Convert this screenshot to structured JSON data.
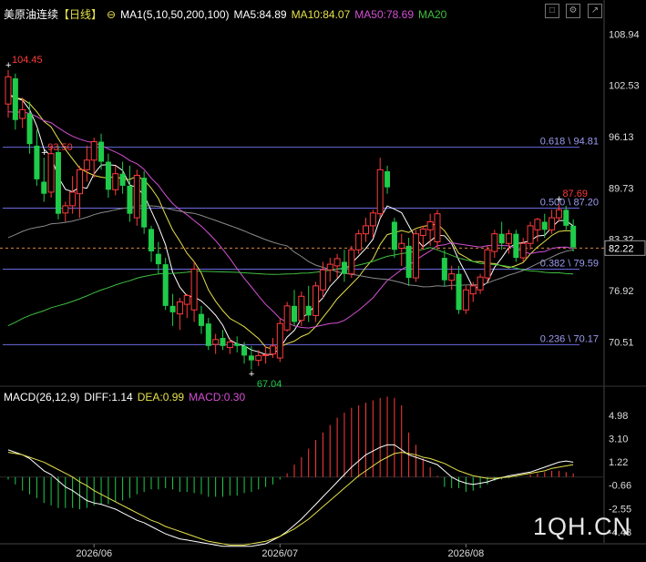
{
  "header": {
    "instrument": "美原油连续",
    "period": "【日线】",
    "ma_group": "MA1(5,10,50,200,100)",
    "ma5": "MA5:84.89",
    "ma10": "MA10:84.07",
    "ma50": "MA50:78.69",
    "ma20": "MA20",
    "colors": {
      "ma5": "#ffffff",
      "ma10": "#e6e04a",
      "ma50": "#d44fd4",
      "ma20": "#3fbf3f",
      "ma_group": "#ffffff"
    }
  },
  "macd_header": {
    "title": "MACD(26,12,9)",
    "diff": "DIFF:1.14",
    "dea": "DEA:0.99",
    "macd": "MACD:0.30"
  },
  "controls": [
    "minimize-icon",
    "settings-icon",
    "expand-icon"
  ],
  "watermark": "1QH.CN",
  "chart_data": [
    {
      "type": "candlestick",
      "price_axis_ticks": [
        "108.94",
        "102.53",
        "96.13",
        "89.73",
        "83.32",
        "76.92",
        "70.51"
      ],
      "ylim": [
        66,
        110
      ],
      "current_price": "82.22",
      "date_labels": [
        "2026/06",
        "2026/07",
        "2026/08"
      ],
      "fibonacci_levels": [
        {
          "ratio": "0.618",
          "price": 94.81,
          "label": "0.618 \\ 94.81"
        },
        {
          "ratio": "0.500",
          "price": 87.2,
          "label": "0.500 \\ 87.20"
        },
        {
          "ratio": "0.382",
          "price": 79.59,
          "label": "0.382 \\ 79.59"
        },
        {
          "ratio": "0.236",
          "price": 70.17,
          "label": "0.236 \\ 70.17"
        }
      ],
      "annotations": [
        {
          "label": "104.45",
          "type": "high"
        },
        {
          "label": "93.50",
          "type": "high"
        },
        {
          "label": "87.69",
          "type": "high"
        },
        {
          "label": "67.04",
          "type": "low"
        }
      ],
      "candles": [
        {
          "o": 100.2,
          "h": 104.45,
          "l": 98.5,
          "c": 103.6
        },
        {
          "o": 103.4,
          "h": 104.0,
          "l": 97.0,
          "c": 98.2
        },
        {
          "o": 98.4,
          "h": 101.0,
          "l": 97.2,
          "c": 99.5
        },
        {
          "o": 99.0,
          "h": 100.5,
          "l": 94.0,
          "c": 95.2
        },
        {
          "o": 95.0,
          "h": 97.0,
          "l": 90.0,
          "c": 90.8
        },
        {
          "o": 90.5,
          "h": 93.5,
          "l": 88.0,
          "c": 89.0
        },
        {
          "o": 89.2,
          "h": 95.0,
          "l": 88.5,
          "c": 94.0
        },
        {
          "o": 94.2,
          "h": 95.0,
          "l": 85.8,
          "c": 86.5
        },
        {
          "o": 86.6,
          "h": 88.0,
          "l": 85.5,
          "c": 87.5
        },
        {
          "o": 87.5,
          "h": 91.2,
          "l": 86.5,
          "c": 89.2
        },
        {
          "o": 89.0,
          "h": 92.5,
          "l": 86.0,
          "c": 92.0
        },
        {
          "o": 92.0,
          "h": 95.0,
          "l": 90.5,
          "c": 93.2
        },
        {
          "o": 93.2,
          "h": 96.0,
          "l": 91.0,
          "c": 95.5
        },
        {
          "o": 95.5,
          "h": 96.5,
          "l": 92.0,
          "c": 93.0
        },
        {
          "o": 93.0,
          "h": 94.0,
          "l": 88.5,
          "c": 89.5
        },
        {
          "o": 89.5,
          "h": 92.5,
          "l": 88.8,
          "c": 91.5
        },
        {
          "o": 91.5,
          "h": 93.0,
          "l": 89.0,
          "c": 90.0
        },
        {
          "o": 90.0,
          "h": 92.5,
          "l": 85.5,
          "c": 86.5
        },
        {
          "o": 86.0,
          "h": 92.0,
          "l": 85.0,
          "c": 91.3
        },
        {
          "o": 91.0,
          "h": 91.8,
          "l": 84.0,
          "c": 84.8
        },
        {
          "o": 84.6,
          "h": 85.0,
          "l": 80.5,
          "c": 81.8
        },
        {
          "o": 81.5,
          "h": 83.0,
          "l": 79.0,
          "c": 80.2
        },
        {
          "o": 80.2,
          "h": 81.0,
          "l": 74.5,
          "c": 75.0
        },
        {
          "o": 75.0,
          "h": 76.5,
          "l": 72.5,
          "c": 74.2
        },
        {
          "o": 74.0,
          "h": 76.0,
          "l": 72.0,
          "c": 75.5
        },
        {
          "o": 75.2,
          "h": 76.5,
          "l": 73.5,
          "c": 76.3
        },
        {
          "o": 74.5,
          "h": 80.5,
          "l": 73.0,
          "c": 79.6
        },
        {
          "o": 74.0,
          "h": 75.0,
          "l": 71.5,
          "c": 72.5
        },
        {
          "o": 72.8,
          "h": 73.5,
          "l": 69.5,
          "c": 70.0
        },
        {
          "o": 70.2,
          "h": 71.5,
          "l": 69.0,
          "c": 70.8
        },
        {
          "o": 71.0,
          "h": 72.0,
          "l": 69.5,
          "c": 70.0
        },
        {
          "o": 69.8,
          "h": 71.0,
          "l": 69.0,
          "c": 70.5
        },
        {
          "o": 70.3,
          "h": 71.2,
          "l": 69.2,
          "c": 70.0
        },
        {
          "o": 70.0,
          "h": 70.5,
          "l": 67.8,
          "c": 68.8
        },
        {
          "o": 68.8,
          "h": 70.0,
          "l": 67.04,
          "c": 68.2
        },
        {
          "o": 68.2,
          "h": 69.5,
          "l": 67.5,
          "c": 68.8
        },
        {
          "o": 68.8,
          "h": 70.0,
          "l": 67.8,
          "c": 68.9
        },
        {
          "o": 69.0,
          "h": 71.0,
          "l": 68.5,
          "c": 70.0
        },
        {
          "o": 68.5,
          "h": 73.5,
          "l": 68.0,
          "c": 72.8
        },
        {
          "o": 72.0,
          "h": 75.5,
          "l": 71.8,
          "c": 75.0
        },
        {
          "o": 75.0,
          "h": 77.0,
          "l": 72.5,
          "c": 73.0
        },
        {
          "o": 73.2,
          "h": 76.8,
          "l": 72.5,
          "c": 76.2
        },
        {
          "o": 75.0,
          "h": 77.5,
          "l": 73.0,
          "c": 73.8
        },
        {
          "o": 73.8,
          "h": 78.0,
          "l": 73.0,
          "c": 77.5
        },
        {
          "o": 77.0,
          "h": 80.5,
          "l": 76.0,
          "c": 79.5
        },
        {
          "o": 79.5,
          "h": 81.0,
          "l": 78.0,
          "c": 80.2
        },
        {
          "o": 80.0,
          "h": 81.5,
          "l": 78.5,
          "c": 80.9
        },
        {
          "o": 80.5,
          "h": 82.0,
          "l": 78.0,
          "c": 79.0
        },
        {
          "o": 79.0,
          "h": 82.5,
          "l": 78.5,
          "c": 82.0
        },
        {
          "o": 82.0,
          "h": 84.5,
          "l": 81.5,
          "c": 84.0
        },
        {
          "o": 84.0,
          "h": 86.0,
          "l": 83.0,
          "c": 85.0
        },
        {
          "o": 85.0,
          "h": 87.0,
          "l": 83.5,
          "c": 86.6
        },
        {
          "o": 86.5,
          "h": 93.5,
          "l": 86.0,
          "c": 92.0
        },
        {
          "o": 91.8,
          "h": 92.5,
          "l": 89.0,
          "c": 89.8
        },
        {
          "o": 85.5,
          "h": 86.0,
          "l": 81.0,
          "c": 82.0
        },
        {
          "o": 82.2,
          "h": 84.0,
          "l": 80.0,
          "c": 82.8
        },
        {
          "o": 82.5,
          "h": 83.5,
          "l": 77.5,
          "c": 78.5
        },
        {
          "o": 78.5,
          "h": 84.5,
          "l": 78.0,
          "c": 84.0
        },
        {
          "o": 83.8,
          "h": 85.0,
          "l": 82.0,
          "c": 84.6
        },
        {
          "o": 84.5,
          "h": 86.5,
          "l": 82.5,
          "c": 85.5
        },
        {
          "o": 83.0,
          "h": 87.0,
          "l": 82.0,
          "c": 86.5
        },
        {
          "o": 81.0,
          "h": 82.0,
          "l": 77.5,
          "c": 78.2
        },
        {
          "o": 78.2,
          "h": 80.0,
          "l": 77.0,
          "c": 79.0
        },
        {
          "o": 79.0,
          "h": 80.0,
          "l": 74.0,
          "c": 74.5
        },
        {
          "o": 74.5,
          "h": 77.5,
          "l": 74.0,
          "c": 77.0
        },
        {
          "o": 76.5,
          "h": 78.0,
          "l": 75.5,
          "c": 77.5
        },
        {
          "o": 77.0,
          "h": 79.0,
          "l": 76.5,
          "c": 78.6
        },
        {
          "o": 78.5,
          "h": 82.5,
          "l": 78.0,
          "c": 82.0
        },
        {
          "o": 81.8,
          "h": 84.5,
          "l": 81.0,
          "c": 84.0
        },
        {
          "o": 84.0,
          "h": 85.5,
          "l": 82.0,
          "c": 82.8
        },
        {
          "o": 82.8,
          "h": 84.5,
          "l": 81.5,
          "c": 84.0
        },
        {
          "o": 84.0,
          "h": 84.5,
          "l": 80.5,
          "c": 81.0
        },
        {
          "o": 81.0,
          "h": 83.5,
          "l": 80.5,
          "c": 82.8
        },
        {
          "o": 82.8,
          "h": 85.5,
          "l": 82.0,
          "c": 85.0
        },
        {
          "o": 84.5,
          "h": 86.0,
          "l": 83.0,
          "c": 85.8
        },
        {
          "o": 85.5,
          "h": 86.5,
          "l": 83.5,
          "c": 84.5
        },
        {
          "o": 84.5,
          "h": 87.0,
          "l": 84.0,
          "c": 86.0
        },
        {
          "o": 86.0,
          "h": 87.69,
          "l": 85.5,
          "c": 87.0
        },
        {
          "o": 87.0,
          "h": 87.5,
          "l": 84.5,
          "c": 85.0
        },
        {
          "o": 85.0,
          "h": 85.8,
          "l": 81.8,
          "c": 82.3
        }
      ]
    },
    {
      "type": "macd",
      "title": "MACD(26,12,9)",
      "axis_ticks": [
        "4.98",
        "3.10",
        "1.22",
        "-0.66",
        "-2.55",
        "-4.43"
      ],
      "ylim": [
        -5.4,
        5.8
      ],
      "histogram": [
        -0.2,
        -0.6,
        -1.1,
        -1.4,
        -1.7,
        -2.1,
        -2.3,
        -2.5,
        -2.5,
        -2.5,
        -2.6,
        -2.5,
        -2.3,
        -2.2,
        -2.2,
        -2.0,
        -1.9,
        -1.7,
        -1.4,
        -1.2,
        -1.0,
        -1.0,
        -0.9,
        -1.0,
        -1.2,
        -1.2,
        -1.3,
        -1.4,
        -1.6,
        -1.6,
        -1.6,
        -1.5,
        -1.5,
        -1.3,
        -1.2,
        -1.0,
        -0.8,
        -0.6,
        -0.2,
        0.3,
        1.0,
        1.6,
        2.3,
        3.0,
        3.6,
        4.2,
        4.8,
        5.2,
        5.6,
        5.8,
        6.0,
        6.2,
        6.4,
        6.5,
        6.4,
        5.8,
        3.6,
        2.6,
        1.5,
        0.8,
        0.1,
        -0.8,
        -0.9,
        -0.9,
        -1.2,
        -1.1,
        -0.9,
        -0.6,
        -0.3,
        -0.2,
        -0.1,
        -0.05,
        0.0,
        0.2,
        0.3,
        0.4,
        0.5,
        0.5,
        0.4,
        0.3
      ],
      "diff": [
        2.2,
        2.0,
        1.8,
        1.5,
        1.0,
        0.5,
        0.2,
        -0.3,
        -0.8,
        -1.1,
        -1.5,
        -1.9,
        -2.1,
        -2.2,
        -2.4,
        -2.6,
        -2.9,
        -3.2,
        -3.5,
        -3.7,
        -4.0,
        -4.3,
        -4.6,
        -4.8,
        -5.0,
        -5.1,
        -5.2,
        -5.3,
        -5.4,
        -5.5,
        -5.6,
        -5.6,
        -5.6,
        -5.6,
        -5.6,
        -5.5,
        -5.4,
        -5.1,
        -4.8,
        -4.4,
        -3.9,
        -3.4,
        -2.8,
        -2.2,
        -1.6,
        -1.0,
        -0.4,
        0.2,
        0.8,
        1.3,
        1.8,
        2.1,
        2.4,
        2.6,
        2.6,
        2.2,
        1.8,
        1.6,
        1.4,
        1.2,
        1.0,
        0.5,
        0.0,
        -0.3,
        -0.5,
        -0.6,
        -0.5,
        -0.4,
        -0.2,
        -0.05,
        0.1,
        0.2,
        0.3,
        0.4,
        0.6,
        0.8,
        1.0,
        1.2,
        1.3,
        1.2
      ],
      "dea": [
        2.0,
        1.9,
        1.8,
        1.6,
        1.4,
        1.2,
        0.9,
        0.6,
        0.3,
        0.0,
        -0.4,
        -0.7,
        -1.1,
        -1.4,
        -1.7,
        -2.0,
        -2.3,
        -2.6,
        -2.9,
        -3.2,
        -3.5,
        -3.7,
        -4.0,
        -4.2,
        -4.4,
        -4.6,
        -4.8,
        -5.0,
        -5.2,
        -5.3,
        -5.4,
        -5.5,
        -5.5,
        -5.5,
        -5.4,
        -5.3,
        -5.2,
        -5.0,
        -4.8,
        -4.5,
        -4.2,
        -3.8,
        -3.4,
        -2.9,
        -2.4,
        -1.9,
        -1.4,
        -0.9,
        -0.4,
        0.1,
        0.5,
        0.9,
        1.3,
        1.6,
        1.9,
        2.0,
        1.9,
        1.8,
        1.6,
        1.5,
        1.3,
        1.1,
        0.8,
        0.5,
        0.3,
        0.1,
        0.0,
        -0.1,
        -0.1,
        -0.05,
        0.0,
        0.1,
        0.2,
        0.3,
        0.4,
        0.5,
        0.7,
        0.8,
        0.9,
        1.0
      ]
    }
  ]
}
